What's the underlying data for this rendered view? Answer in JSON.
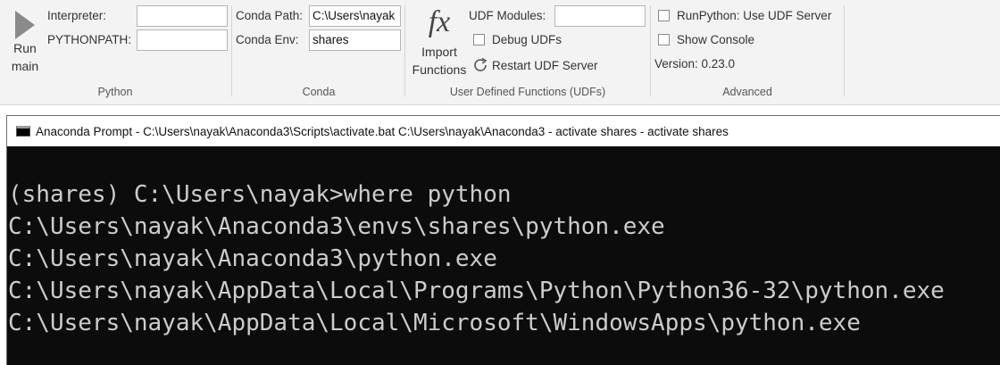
{
  "ribbon": {
    "python_group": {
      "run_label_1": "Run",
      "run_label_2": "main",
      "interpreter_label": "Interpreter:",
      "interpreter_value": "",
      "pythonpath_label": "PYTHONPATH:",
      "pythonpath_value": "",
      "group_label": "Python"
    },
    "conda_group": {
      "path_label": "Conda Path:",
      "path_value": "C:\\Users\\nayak",
      "env_label": "Conda Env:",
      "env_value": "shares",
      "group_label": "Conda"
    },
    "udf_group": {
      "fx_glyph": "fx",
      "import_label_1": "Import",
      "import_label_2": "Functions",
      "modules_label": "UDF Modules:",
      "modules_value": "",
      "debug_label": "Debug UDFs",
      "debug_checked": false,
      "restart_label": "Restart UDF Server",
      "group_label": "User Defined Functions (UDFs)"
    },
    "advanced_group": {
      "runpython_label": "RunPython: Use UDF Server",
      "runpython_checked": false,
      "console_label": "Show Console",
      "console_checked": false,
      "version_label": "Version: 0.23.0",
      "group_label": "Advanced"
    }
  },
  "terminal": {
    "title": "Anaconda Prompt - C:\\Users\\nayak\\Anaconda3\\Scripts\\activate.bat  C:\\Users\\nayak\\Anaconda3 - activate  shares - activate  shares",
    "lines": [
      "(shares) C:\\Users\\nayak>where python",
      "C:\\Users\\nayak\\Anaconda3\\envs\\shares\\python.exe",
      "C:\\Users\\nayak\\Anaconda3\\python.exe",
      "C:\\Users\\nayak\\AppData\\Local\\Programs\\Python\\Python36-32\\python.exe",
      "C:\\Users\\nayak\\AppData\\Local\\Microsoft\\WindowsApps\\python.exe"
    ]
  },
  "icons": {
    "run": "play-triangle-icon",
    "import": "fx-icon",
    "restart": "refresh-icon",
    "window": "console-icon"
  }
}
